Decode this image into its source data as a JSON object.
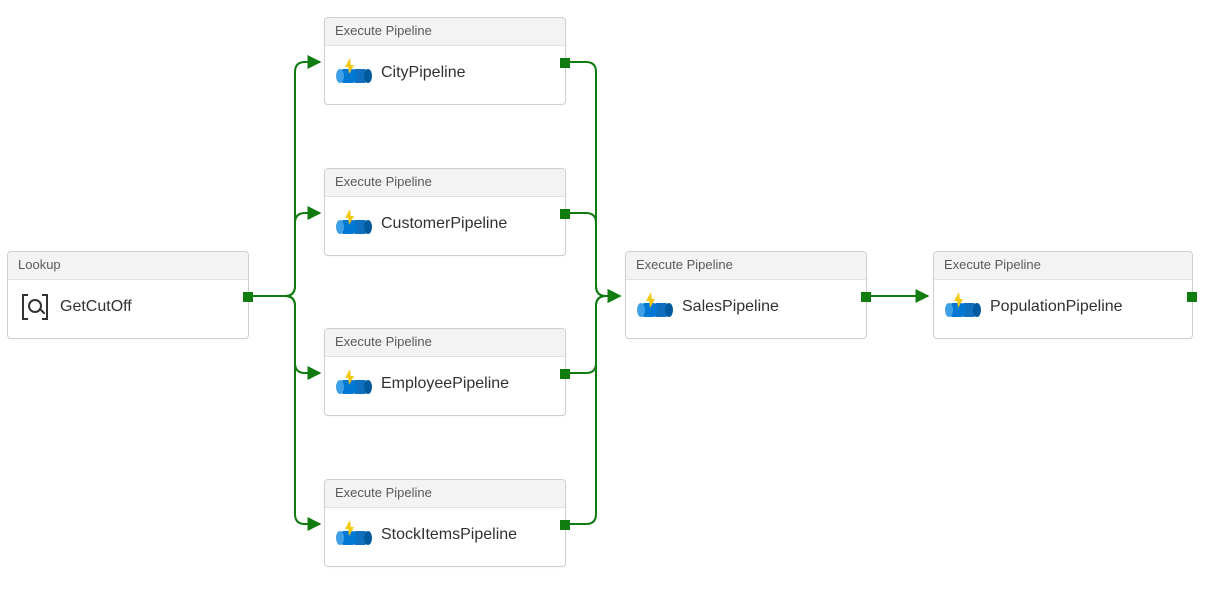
{
  "nodes": {
    "lookup": {
      "header": "Lookup",
      "label": "GetCutOff"
    },
    "city": {
      "header": "Execute Pipeline",
      "label": "CityPipeline"
    },
    "customer": {
      "header": "Execute Pipeline",
      "label": "CustomerPipeline"
    },
    "employee": {
      "header": "Execute Pipeline",
      "label": "EmployeePipeline"
    },
    "stockitems": {
      "header": "Execute Pipeline",
      "label": "StockItemsPipeline"
    },
    "sales": {
      "header": "Execute Pipeline",
      "label": "SalesPipeline"
    },
    "population": {
      "header": "Execute Pipeline",
      "label": "PopulationPipeline"
    }
  },
  "colors": {
    "connector": "#107c10"
  }
}
